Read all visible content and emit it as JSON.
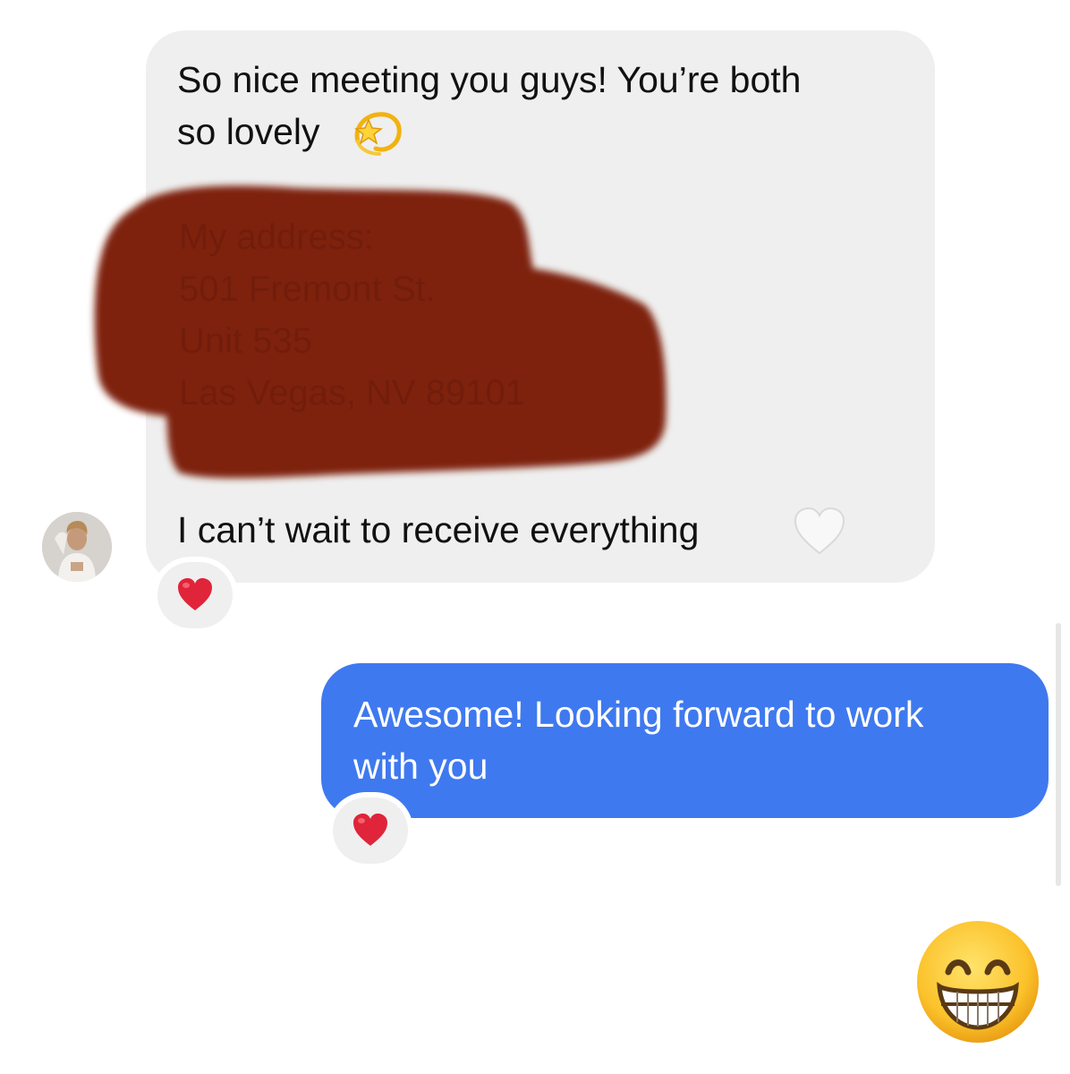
{
  "conversation": {
    "incoming": {
      "line1": "So nice meeting you guys! You’re both",
      "line2": "so lovely",
      "line2_emoji": "dizzy-emoji",
      "redacted_lines": [
        "My address:",
        "501 Fremont St.",
        "Unit 535",
        "Las Vegas, NV 89101"
      ],
      "line3": "I can’t wait to receive everything",
      "line3_emoji": "white-heart-emoji",
      "reaction": "red-heart-emoji"
    },
    "outgoing": {
      "line1": "Awesome! Looking forward to work",
      "line2": "with you",
      "reaction": "red-heart-emoji"
    },
    "last_message_emoji": "grinning-face-with-smiling-eyes-emoji"
  },
  "colors": {
    "incoming_bubble": "#efefef",
    "outgoing_bubble": "#3f79ef",
    "redaction": "#7e2010",
    "heart": "#e0243a"
  }
}
